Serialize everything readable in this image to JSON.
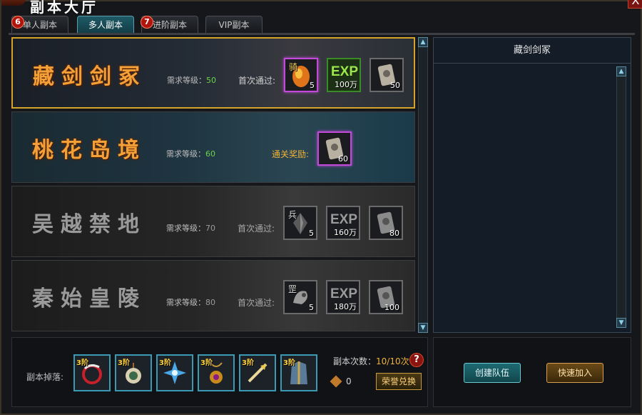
{
  "window": {
    "title": "副本大厅",
    "close_label": "X"
  },
  "tabs": [
    {
      "label": "单人副本",
      "badge": "6"
    },
    {
      "label": "多人副本",
      "badge": ""
    },
    {
      "label": "进阶副本",
      "badge": "7"
    },
    {
      "label": "VIP副本",
      "badge": ""
    }
  ],
  "dungeons": [
    {
      "name": "藏剑剑冢",
      "level_label": "需求等级：",
      "level": "50",
      "reward_label": "首次通过:",
      "items": [
        {
          "tag": "骑",
          "count": "5",
          "icon": "orange-egg-icon"
        },
        {
          "tag": "",
          "count": "100万",
          "icon": "exp-icon",
          "exp": "EXP"
        },
        {
          "tag": "",
          "count": "50",
          "icon": "token-icon"
        }
      ]
    },
    {
      "name": "桃花岛境",
      "level_label": "需求等级：",
      "level": "60",
      "reward_label": "通关奖励:",
      "items": [
        {
          "tag": "",
          "count": "60",
          "icon": "token-icon"
        }
      ]
    },
    {
      "name": "吴越禁地",
      "level_label": "需求等级：",
      "level": "70",
      "reward_label": "首次通过:",
      "items": [
        {
          "tag": "兵",
          "count": "5",
          "icon": "crystal-icon"
        },
        {
          "tag": "",
          "count": "160万",
          "icon": "exp-icon",
          "exp": "EXP"
        },
        {
          "tag": "",
          "count": "80",
          "icon": "token-icon"
        }
      ]
    },
    {
      "name": "秦始皇陵",
      "level_label": "需求等级：",
      "level": "80",
      "reward_label": "首次通过:",
      "items": [
        {
          "tag": "罡",
          "count": "5",
          "icon": "dragon-charm-icon"
        },
        {
          "tag": "",
          "count": "180万",
          "icon": "exp-icon",
          "exp": "EXP"
        },
        {
          "tag": "",
          "count": "100",
          "icon": "token-icon"
        }
      ]
    }
  ],
  "detail": {
    "title": "藏剑剑冢"
  },
  "bottom": {
    "drop_label": "副本掉落:",
    "drops": [
      {
        "lv": "3阶",
        "icon": "dragon-ring-icon"
      },
      {
        "lv": "3阶",
        "icon": "orb-pendant-icon"
      },
      {
        "lv": "3阶",
        "icon": "star-gem-icon"
      },
      {
        "lv": "3阶",
        "icon": "amulet-icon"
      },
      {
        "lv": "3阶",
        "icon": "arrow-icon"
      },
      {
        "lv": "3阶",
        "icon": "armor-icon"
      }
    ],
    "count_label": "副本次数：",
    "count_value": "10/10次",
    "help": "?",
    "honor_value": "0",
    "honor_button": "荣誉兑换"
  },
  "actions": {
    "create_team": "创建队伍",
    "quick_join": "快速加入"
  },
  "colors": {
    "accent_gold": "#d4a42a",
    "level_green": "#6cd24a",
    "reward_gold": "#f0b23a"
  }
}
